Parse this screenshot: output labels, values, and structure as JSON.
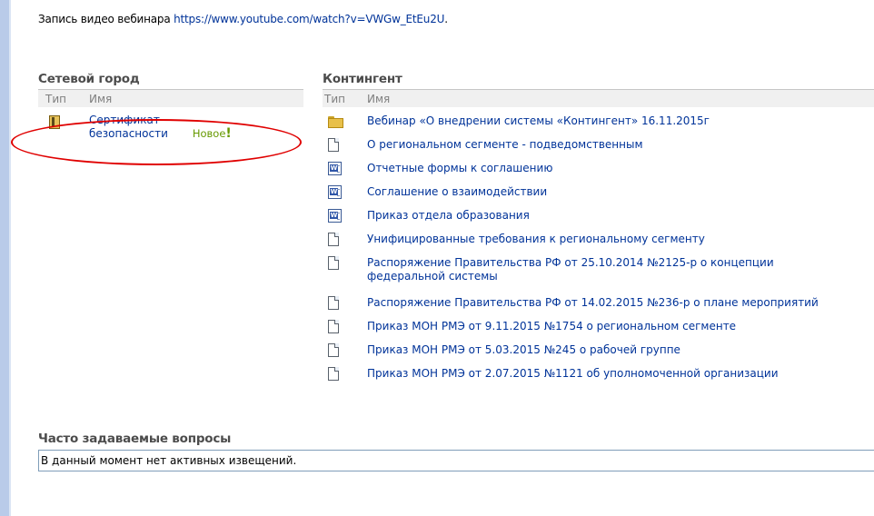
{
  "intro": {
    "text": "Запись видео вебинара ",
    "link": "https://www.youtube.com/watch?v=VWGw_EtEu2U",
    "suffix": "."
  },
  "left_zone": {
    "title": "Сетевой город",
    "col_type": "Тип",
    "col_name": "Имя",
    "items": [
      {
        "icon": "certificate-icon",
        "name": "Сертификат безопасности",
        "badge": "Новое",
        "badge_mark": "!"
      }
    ]
  },
  "right_zone": {
    "title": "Контингент",
    "col_type": "Тип",
    "col_name": "Имя",
    "items": [
      {
        "icon": "folder-icon",
        "name": "Вебинар «О внедрении системы «Контингент» 16.11.2015г"
      },
      {
        "icon": "document-icon",
        "name": "О региональном сегменте - подведомственным"
      },
      {
        "icon": "word-document-icon",
        "name": "Отчетные формы к соглашению"
      },
      {
        "icon": "word-document-icon",
        "name": "Соглашение о взаимодействии"
      },
      {
        "icon": "word-document-icon",
        "name": "Приказ отдела образования"
      },
      {
        "icon": "document-icon",
        "name": "Унифицированные требования к региональному сегменту"
      },
      {
        "icon": "document-icon",
        "name": "Распоряжение Правительства РФ от 25.10.2014 №2125-р о концепции федеральной системы"
      },
      {
        "icon": "document-icon",
        "name": "Распоряжение Правительства РФ от 14.02.2015 №236-р о плане мероприятий"
      },
      {
        "icon": "document-icon",
        "name": "Приказ МОН РМЭ от 9.11.2015 №1754 о региональном сегменте"
      },
      {
        "icon": "document-icon",
        "name": "Приказ МОН РМЭ от 5.03.2015 №245 о рабочей группе"
      },
      {
        "icon": "document-icon",
        "name": "Приказ МОН РМЭ от 2.07.2015 №1121 об уполномоченной организации"
      }
    ]
  },
  "faq": {
    "title": "Часто задаваемые вопросы",
    "message": "В данный момент нет активных извещений."
  },
  "colors": {
    "link": "#003399",
    "new_badge": "#669900",
    "highlight_ellipse": "#e00000",
    "left_bar": "#b9cbe9"
  }
}
